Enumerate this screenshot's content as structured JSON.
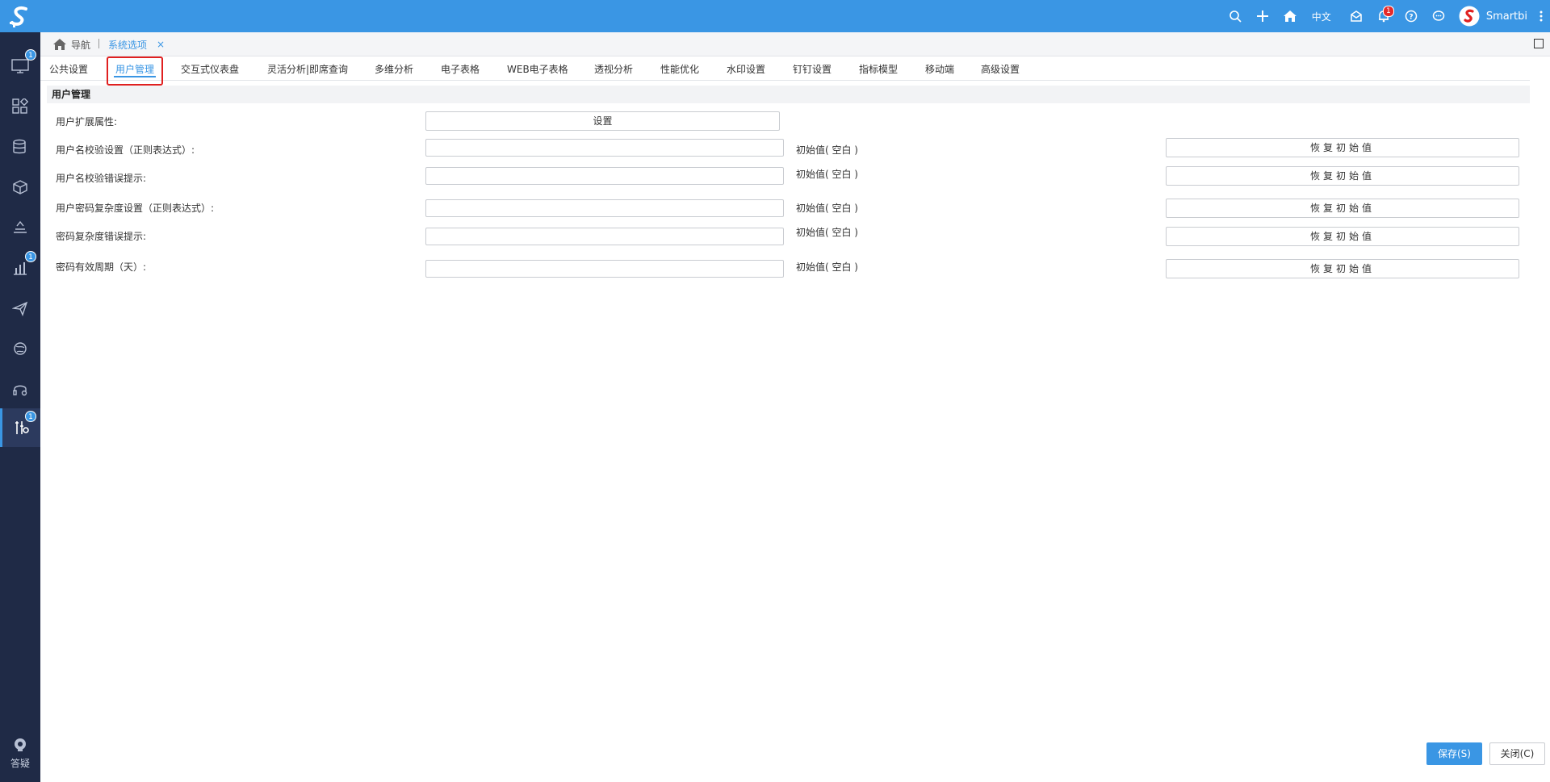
{
  "topbar": {
    "lang": "中文",
    "notification_count": "1",
    "username": "Smartbi",
    "icons": [
      "search-icon",
      "plus-icon",
      "home-icon",
      "mailbox-icon",
      "bell-icon",
      "help-icon",
      "chat-icon",
      "avatar",
      "more-icon"
    ]
  },
  "sidebar": {
    "items": [
      {
        "icon": "monitor-icon",
        "badge": "1"
      },
      {
        "icon": "apps-icon",
        "badge": ""
      },
      {
        "icon": "database-icon",
        "badge": ""
      },
      {
        "icon": "cube-icon",
        "badge": ""
      },
      {
        "icon": "layers-icon",
        "badge": ""
      },
      {
        "icon": "bar-chart-icon",
        "badge": "1"
      },
      {
        "icon": "send-icon",
        "badge": ""
      },
      {
        "icon": "refresh-globe-icon",
        "badge": ""
      },
      {
        "icon": "headset-icon",
        "badge": ""
      },
      {
        "icon": "tools-icon",
        "badge": "1"
      }
    ],
    "help_label": "答疑"
  },
  "breadcrumb": {
    "home_label": "导航",
    "tab_label": "系统选项",
    "close_symbol": "×"
  },
  "subtabs": [
    {
      "label": "公共设置"
    },
    {
      "label": "用户管理"
    },
    {
      "label": "交互式仪表盘"
    },
    {
      "label": "灵活分析|即席查询"
    },
    {
      "label": "多维分析"
    },
    {
      "label": "电子表格"
    },
    {
      "label": "WEB电子表格"
    },
    {
      "label": "透视分析"
    },
    {
      "label": "性能优化"
    },
    {
      "label": "水印设置"
    },
    {
      "label": "钉钉设置"
    },
    {
      "label": "指标模型"
    },
    {
      "label": "移动端"
    },
    {
      "label": "高级设置"
    }
  ],
  "section": {
    "title": "用户管理",
    "ext_attr_label": "用户扩展属性:",
    "ext_attr_button": "设置",
    "rows": [
      {
        "label": "用户名校验设置（正则表达式）:",
        "value": "",
        "initial": "初始值( 空白 )",
        "restore": "恢复初始值"
      },
      {
        "label": "用户名校验错误提示:",
        "value": "",
        "initial": "初始值( 空白 )",
        "restore": "恢复初始值"
      },
      {
        "label": "用户密码复杂度设置（正则表达式）:",
        "value": "",
        "initial": "初始值( 空白 )",
        "restore": "恢复初始值"
      },
      {
        "label": "密码复杂度错误提示:",
        "value": "",
        "initial": "初始值( 空白 )",
        "restore": "恢复初始值"
      },
      {
        "label": "密码有效周期（天）:",
        "value": "",
        "initial": "初始值( 空白 )",
        "restore": "恢复初始值"
      }
    ]
  },
  "footer": {
    "save_label": "保存(S)",
    "close_label": "关闭(C)"
  },
  "colors": {
    "brand": "#3a96e4",
    "sidebar_bg": "#1f2a46",
    "highlight": "#e02020"
  }
}
